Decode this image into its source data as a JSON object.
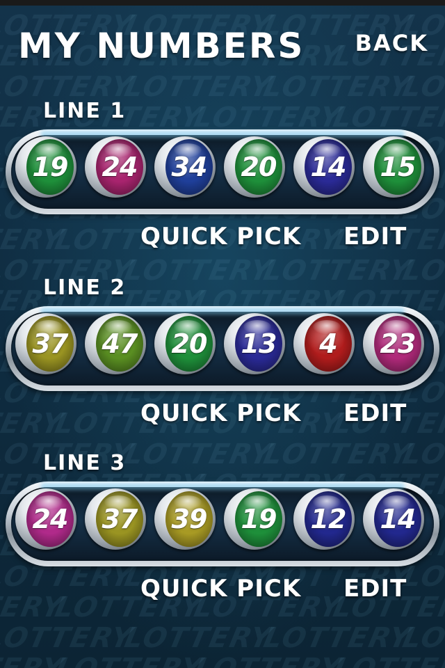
{
  "header": {
    "title": "MY NUMBERS",
    "back_label": "BACK"
  },
  "background": {
    "watermark_text": "LOTTERY"
  },
  "lines": [
    {
      "label": "LINE 1",
      "quick_pick_label": "QUICK PICK",
      "edit_label": "EDIT",
      "balls": [
        {
          "number": "19",
          "color": "#1e8f3a"
        },
        {
          "number": "24",
          "color": "#a8246e"
        },
        {
          "number": "34",
          "color": "#1f3f9a"
        },
        {
          "number": "20",
          "color": "#1e8f3a"
        },
        {
          "number": "14",
          "color": "#2a2a96"
        },
        {
          "number": "15",
          "color": "#1e8f3a"
        }
      ]
    },
    {
      "label": "LINE 2",
      "quick_pick_label": "QUICK PICK",
      "edit_label": "EDIT",
      "balls": [
        {
          "number": "37",
          "color": "#9a9422"
        },
        {
          "number": "47",
          "color": "#5a8f22"
        },
        {
          "number": "20",
          "color": "#1e8f3a"
        },
        {
          "number": "13",
          "color": "#2a2a96"
        },
        {
          "number": "4",
          "color": "#b01c1c"
        },
        {
          "number": "23",
          "color": "#b02a7a"
        }
      ]
    },
    {
      "label": "LINE 3",
      "quick_pick_label": "QUICK PICK",
      "edit_label": "EDIT",
      "balls": [
        {
          "number": "24",
          "color": "#b02a8a"
        },
        {
          "number": "37",
          "color": "#9a9422"
        },
        {
          "number": "39",
          "color": "#a89a24"
        },
        {
          "number": "19",
          "color": "#1e8f3a"
        },
        {
          "number": "12",
          "color": "#22288e"
        },
        {
          "number": "14",
          "color": "#22288e"
        }
      ]
    }
  ]
}
